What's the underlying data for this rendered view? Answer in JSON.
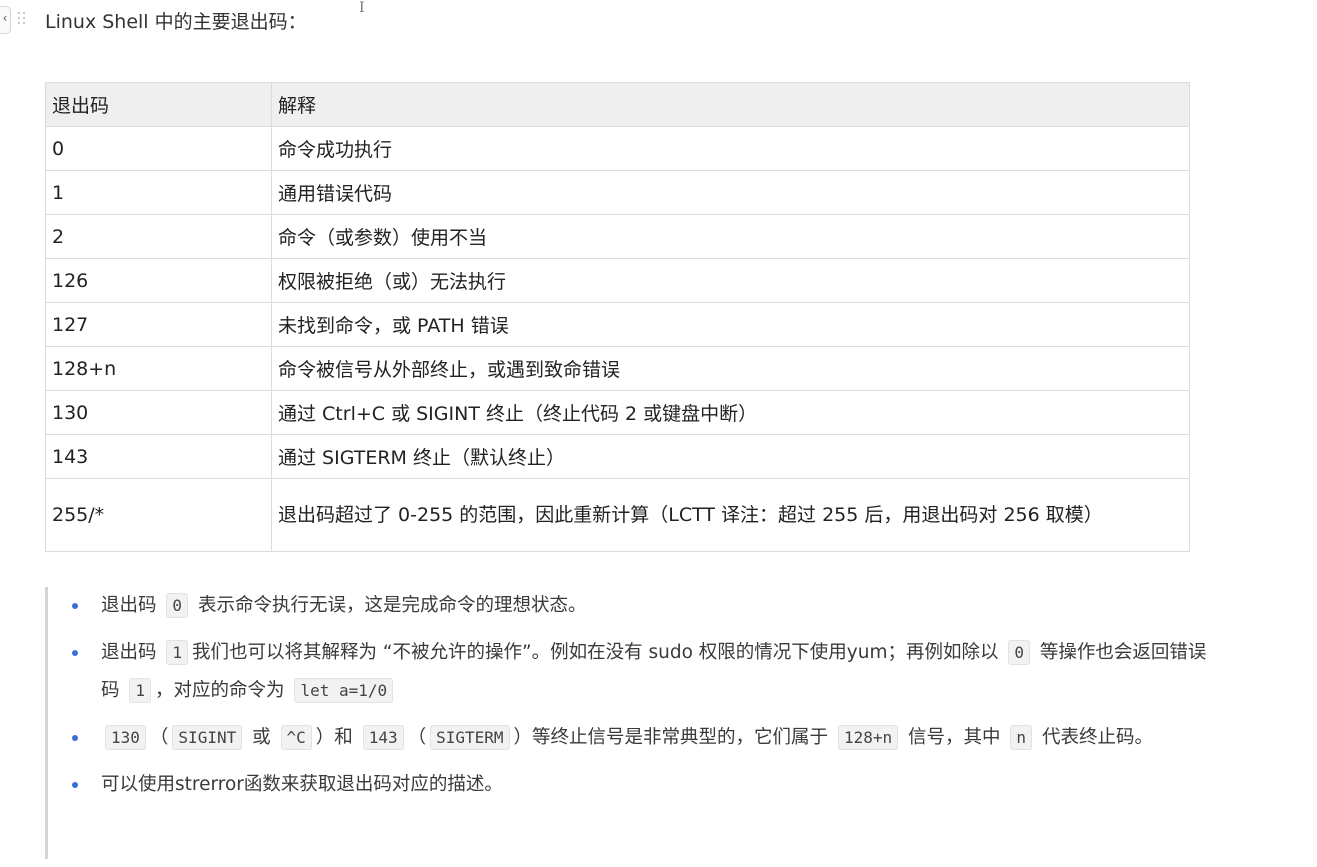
{
  "heading": {
    "text": "Linux Shell 中的主要退出码：",
    "cursor": "I"
  },
  "table": {
    "headers": [
      "退出码",
      "解释"
    ],
    "rows": [
      {
        "code": "0",
        "desc": "命令成功执行"
      },
      {
        "code": "1",
        "desc": "通用错误代码"
      },
      {
        "code": "2",
        "desc": "命令（或参数）使用不当"
      },
      {
        "code": "126",
        "desc": "权限被拒绝（或）无法执行"
      },
      {
        "code": "127",
        "desc": "未找到命令，或 PATH 错误"
      },
      {
        "code": "128+n",
        "desc": "命令被信号从外部终止，或遇到致命错误"
      },
      {
        "code": "130",
        "desc": "通过 Ctrl+C 或 SIGINT 终止（终止代码 2 或键盘中断）"
      },
      {
        "code": "143",
        "desc": "通过 SIGTERM 终止（默认终止）"
      },
      {
        "code": "255/*",
        "desc": "退出码超过了 0-255 的范围，因此重新计算（LCTT 译注：超过 255 后，用退出码对 256 取模）"
      }
    ]
  },
  "notes": {
    "item1": {
      "t1": "退出码",
      "c1": "0",
      "t2": "表示命令执行无误，这是完成命令的理想状态。"
    },
    "item2": {
      "t1": "退出码",
      "c1": "1",
      "t2": "我们也可以将其解释为 “不被允许的操作”。例如在没有 sudo 权限的情况下使用yum；再例如除以",
      "c2": "0",
      "t3": "等操作也会返回错误码",
      "c3": "1",
      "t4": "，对应的命令为",
      "c4": "let a=1/0"
    },
    "item3": {
      "c1": "130",
      "t1": "（",
      "c2": "SIGINT",
      "t2": "或",
      "c3": "^C",
      "t3": "）和",
      "c4": "143",
      "t4": "（",
      "c5": "SIGTERM",
      "t5": "）等终止信号是非常典型的，它们属于",
      "c6": "128+n",
      "t6": "信号，其中",
      "c7": "n",
      "t7": "代表终止码。"
    },
    "item4": {
      "t1": "可以使用strerror函数来获取退出码对应的描述。"
    }
  }
}
